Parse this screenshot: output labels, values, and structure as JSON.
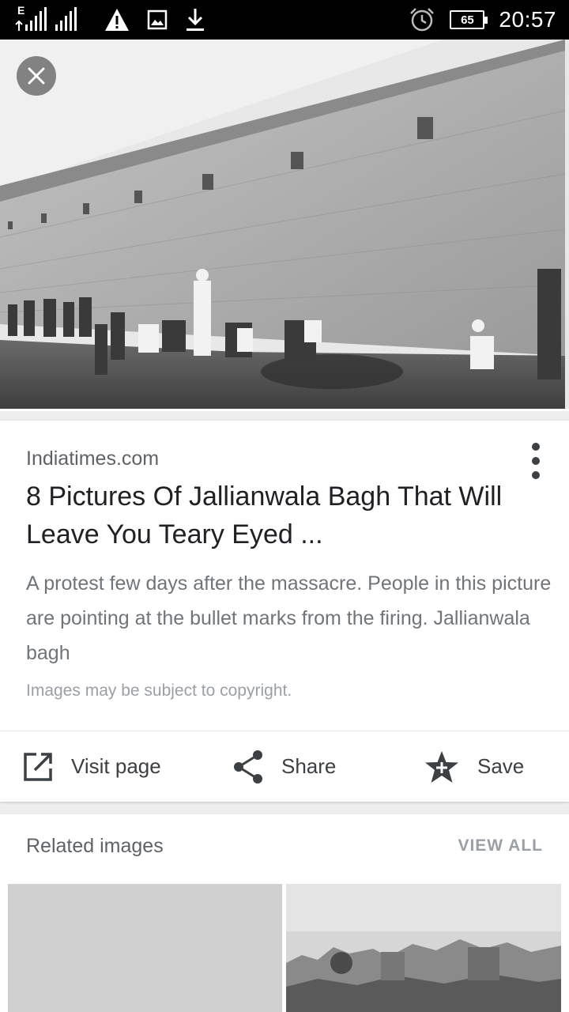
{
  "status_bar": {
    "network_label": "E",
    "battery_level": "65",
    "time": "20:57",
    "icons": [
      "signal-icon",
      "signal-icon",
      "warning-icon",
      "image-icon",
      "download-icon",
      "alarm-icon",
      "battery-icon"
    ]
  },
  "hero": {
    "close_icon": "close-icon"
  },
  "result": {
    "source": "Indiatimes.com",
    "title": "8 Pictures Of Jallianwala Bagh That Will Leave You Teary Eyed ...",
    "description": "A protest few days after the massacre. People in this picture are pointing at the bullet marks from the firing. Jallianwala bagh",
    "copyright": "Images may be subject to copyright.",
    "actions": {
      "visit_label": "Visit page",
      "share_label": "Share",
      "save_label": "Save"
    }
  },
  "related": {
    "title": "Related images",
    "view_all": "VIEW ALL"
  },
  "colors": {
    "status_bar": "#000000",
    "card": "#ffffff",
    "page_bg": "#eeeeee",
    "title_text": "#202124",
    "secondary_text": "#70757a"
  }
}
